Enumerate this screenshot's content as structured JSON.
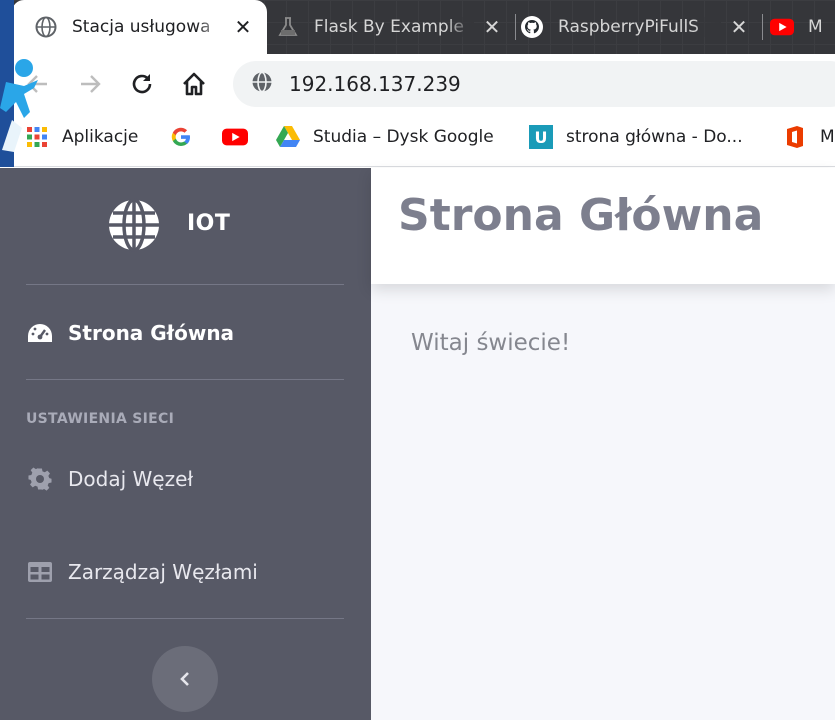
{
  "browser": {
    "tabs": [
      {
        "title": "Stacja usługowa",
        "active": true,
        "favicon": "globe-icon"
      },
      {
        "title": "Flask By Example",
        "active": false,
        "favicon": "flask-icon"
      },
      {
        "title": "RaspberryPiFullS",
        "active": false,
        "favicon": "github-icon"
      },
      {
        "title": "M",
        "active": false,
        "favicon": "youtube-icon"
      }
    ],
    "url": "192.168.137.239",
    "bookmarks": [
      {
        "label": "Aplikacje",
        "icon": "apps-grid-icon"
      },
      {
        "label": "",
        "icon": "google-icon"
      },
      {
        "label": "",
        "icon": "youtube-icon"
      },
      {
        "label": "Studia – Dysk Google",
        "icon": "google-drive-icon"
      },
      {
        "label": "strona główna - Do...",
        "icon": "u-icon"
      },
      {
        "label": "M",
        "icon": "office-icon"
      }
    ]
  },
  "sidebar": {
    "brand": "IOT",
    "items": [
      {
        "label": "Strona Główna",
        "icon": "dashboard-gauge-icon",
        "active": true
      },
      {
        "label": "Dodaj Węzeł",
        "icon": "gear-icon",
        "active": false
      },
      {
        "label": "Zarządzaj Węzłami",
        "icon": "table-icon",
        "active": false
      }
    ],
    "section_heading": "USTAWIENIA SIECI",
    "collapse_icon": "chevron-left-icon"
  },
  "main": {
    "title": "Strona Główna",
    "welcome": "Witaj świecie!"
  },
  "colors": {
    "sidebar_bg": "#575966",
    "content_bg": "#f6f7fb",
    "title_color": "#7d7f8e"
  }
}
